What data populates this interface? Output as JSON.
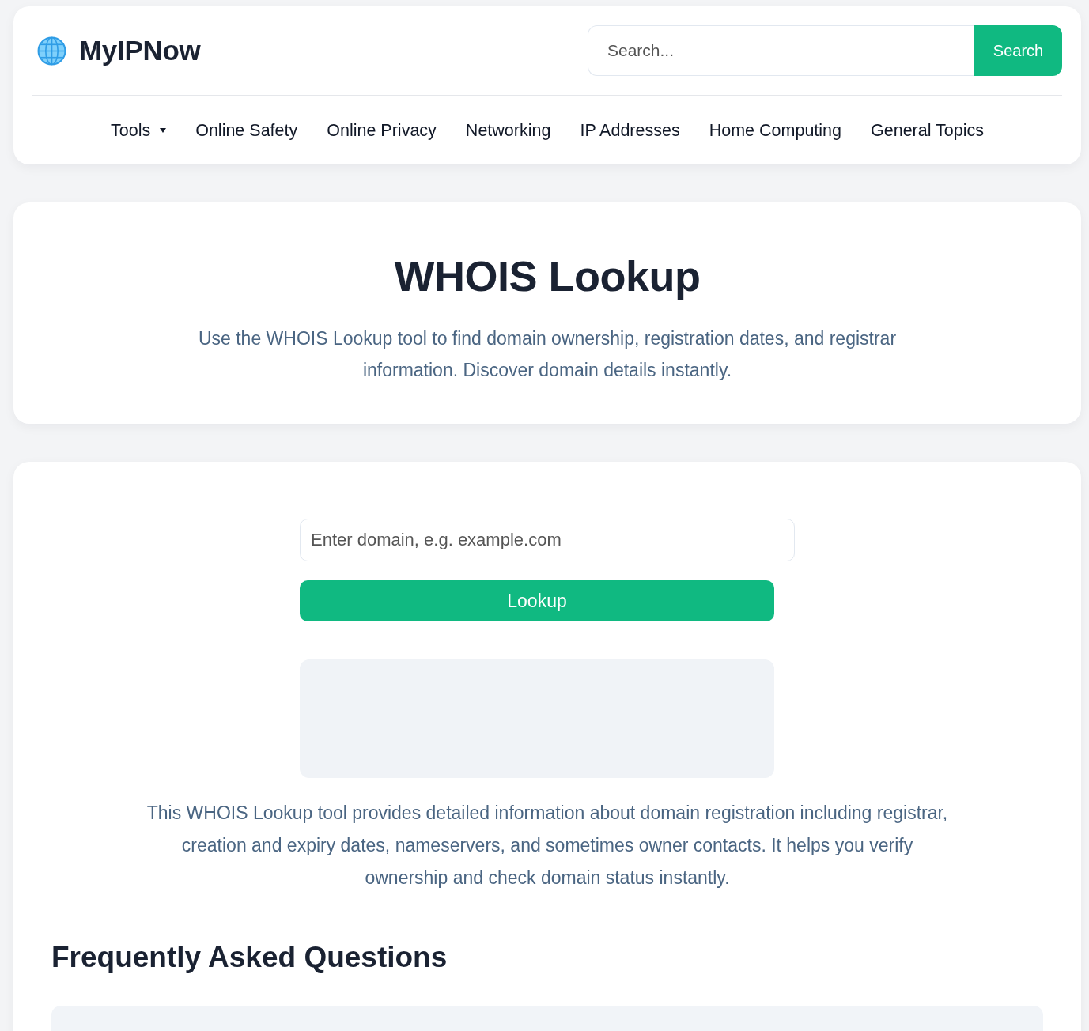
{
  "header": {
    "logo": {
      "text": "MyIPNow"
    },
    "search": {
      "placeholder": "Search...",
      "button": "Search"
    }
  },
  "nav": [
    {
      "label": "Tools",
      "kind": "dropdown"
    },
    {
      "label": "Online Safety",
      "kind": "link"
    },
    {
      "label": "Online Privacy",
      "kind": "link"
    },
    {
      "label": "Networking",
      "kind": "link"
    },
    {
      "label": "IP Addresses",
      "kind": "link"
    },
    {
      "label": "Home Computing",
      "kind": "link"
    },
    {
      "label": "General Topics",
      "kind": "link"
    }
  ],
  "hero": {
    "title": "WHOIS Lookup",
    "subtitle": "Use the WHOIS Lookup tool to find domain ownership, registration dates, and registrar information. Discover domain details instantly."
  },
  "tool": {
    "domain_field": {
      "placeholder": "Enter domain, e.g. example.com"
    },
    "button": "Lookup",
    "description": "This WHOIS Lookup tool provides detailed information about domain registration including registrar, creation and expiry dates, nameservers, and sometimes owner contacts. It helps you verify ownership and check domain status instantly."
  },
  "faq": {
    "heading": "Frequently Asked Questions"
  }
}
